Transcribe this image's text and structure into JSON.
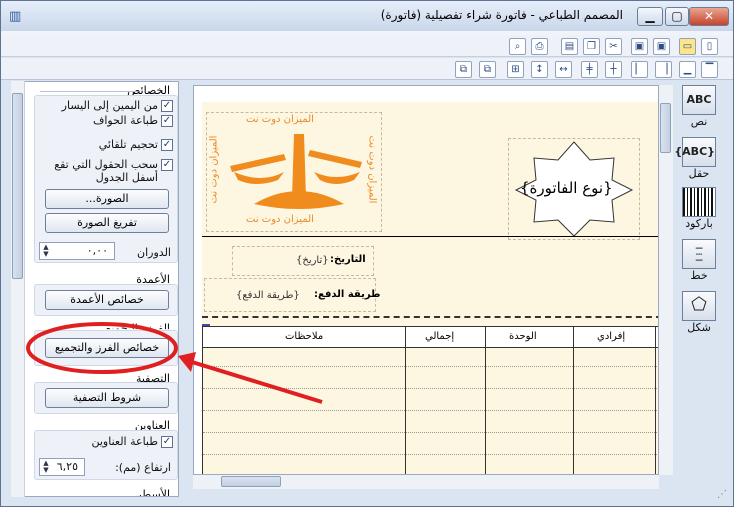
{
  "window": {
    "title": "المصمم الطباعي - فاتورة شراء تفصيلية (فاتورة)"
  },
  "left_panel": {
    "properties": {
      "heading": "الخصائص",
      "rtl_label": "من اليمين إلى اليسار",
      "print_edges_label": "طباعة الحواف",
      "auto_size_label": "تحجيم تلقائي",
      "drag_fields_label": "سحب الحقول التي تقع أسفل الجدول",
      "image_button": "الصورة...",
      "clear_image_button": "تفريغ الصورة",
      "rotation_label": "الدوران",
      "rotation_value": "٠,٠٠"
    },
    "columns": {
      "heading": "الأعمدة",
      "button": "خصائص الأعمدة"
    },
    "sort_group": {
      "heading": "الفرز والتجميع",
      "button": "خصائص الفرز والتجميع"
    },
    "filter": {
      "heading": "التصفية",
      "button": "شروط التصفية"
    },
    "titles": {
      "heading": "العناوين",
      "print_titles_label": "طباعة العناوين",
      "height_label": "ارتفاع (مم):",
      "height_value": "٦,٢٥"
    },
    "lines": {
      "heading": "الأسطر"
    }
  },
  "canvas": {
    "logo_text": "الميزان دوت نت",
    "invoice_type": "{نوع الفاتورة}",
    "date_label": "التاريخ:",
    "date_value": "{تاريخ}",
    "payment_label": "طريقة الدفع:",
    "payment_value": "{طريقة الدفع}",
    "table_headers": [
      "إفرادي",
      "الوحدة",
      "إجمالي",
      "ملاحظات"
    ]
  },
  "toolbox": {
    "text": "نص",
    "text_icon": "ABC",
    "field": "حقل",
    "field_icon": "{ABC}",
    "barcode": "باركود",
    "line": "خط",
    "shape": "شكل"
  },
  "colors": {
    "accent": "#f08c1e",
    "annotation": "#e02020"
  }
}
